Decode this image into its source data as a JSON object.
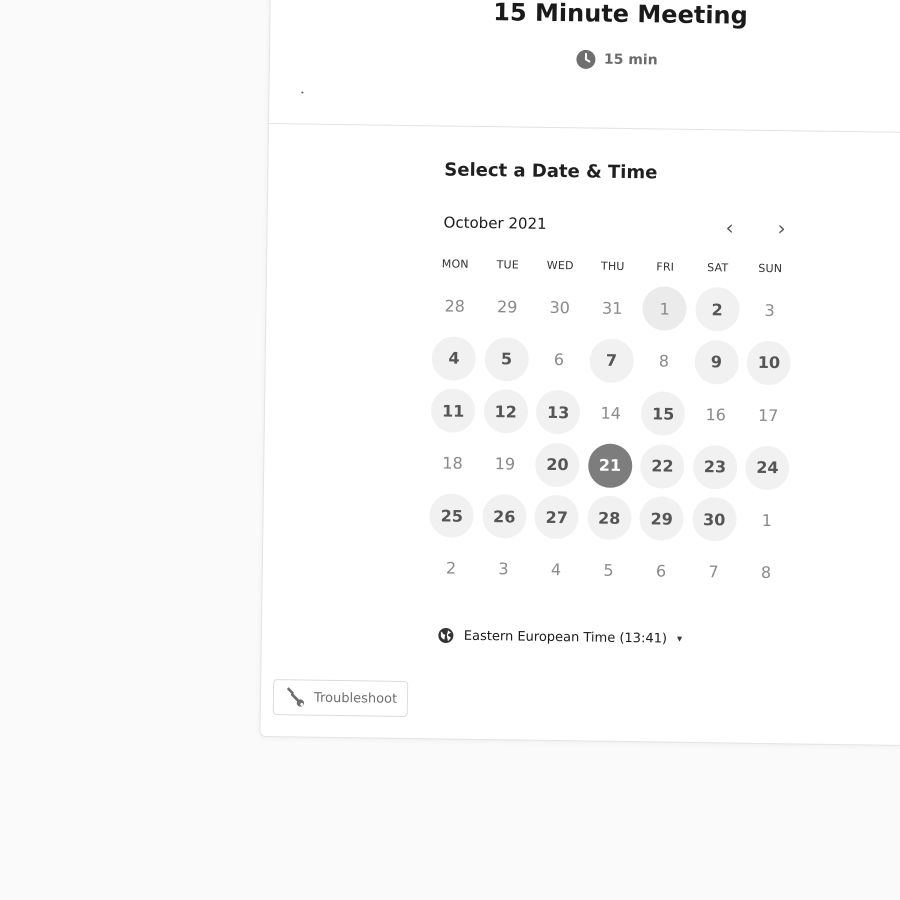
{
  "event": {
    "title": "15 Minute Meeting",
    "duration": "15 min",
    "clock_icon": "clock-icon"
  },
  "picker": {
    "title": "Select a Date & Time",
    "month": "October 2021",
    "prev_icon": "chevron-left-icon",
    "next_icon": "chevron-right-icon",
    "prev_glyph": "‹",
    "next_glyph": "›",
    "weekdays": [
      "MON",
      "TUE",
      "WED",
      "THU",
      "FRI",
      "SAT",
      "SUN"
    ],
    "days": [
      {
        "label": "28",
        "state": "outside"
      },
      {
        "label": "29",
        "state": "outside"
      },
      {
        "label": "30",
        "state": "outside"
      },
      {
        "label": "31",
        "state": "outside"
      },
      {
        "label": "1",
        "state": "today"
      },
      {
        "label": "2",
        "state": "available"
      },
      {
        "label": "3",
        "state": "unavailable"
      },
      {
        "label": "4",
        "state": "available"
      },
      {
        "label": "5",
        "state": "available"
      },
      {
        "label": "6",
        "state": "unavailable"
      },
      {
        "label": "7",
        "state": "available"
      },
      {
        "label": "8",
        "state": "unavailable"
      },
      {
        "label": "9",
        "state": "available"
      },
      {
        "label": "10",
        "state": "available"
      },
      {
        "label": "11",
        "state": "available"
      },
      {
        "label": "12",
        "state": "available"
      },
      {
        "label": "13",
        "state": "available"
      },
      {
        "label": "14",
        "state": "unavailable"
      },
      {
        "label": "15",
        "state": "available"
      },
      {
        "label": "16",
        "state": "unavailable"
      },
      {
        "label": "17",
        "state": "unavailable"
      },
      {
        "label": "18",
        "state": "unavailable"
      },
      {
        "label": "19",
        "state": "unavailable"
      },
      {
        "label": "20",
        "state": "available"
      },
      {
        "label": "21",
        "state": "selected"
      },
      {
        "label": "22",
        "state": "available"
      },
      {
        "label": "23",
        "state": "available"
      },
      {
        "label": "24",
        "state": "available"
      },
      {
        "label": "25",
        "state": "available"
      },
      {
        "label": "26",
        "state": "available"
      },
      {
        "label": "27",
        "state": "available"
      },
      {
        "label": "28",
        "state": "available"
      },
      {
        "label": "29",
        "state": "available"
      },
      {
        "label": "30",
        "state": "available"
      },
      {
        "label": "1",
        "state": "outside"
      },
      {
        "label": "2",
        "state": "outside"
      },
      {
        "label": "3",
        "state": "outside"
      },
      {
        "label": "4",
        "state": "outside"
      },
      {
        "label": "5",
        "state": "outside"
      },
      {
        "label": "6",
        "state": "outside"
      },
      {
        "label": "7",
        "state": "outside"
      },
      {
        "label": "8",
        "state": "outside"
      }
    ]
  },
  "timezone": {
    "label": "Eastern European Time (13:41)",
    "icon": "globe-icon",
    "caret": "▾"
  },
  "troubleshoot": {
    "label": "Troubleshoot",
    "icon": "wrench-icon"
  },
  "colors": {
    "page_bg": "#fafafa",
    "card_bg": "#ffffff",
    "selected_day": "#7d7d7d",
    "available_day": "#f1f1f1"
  }
}
